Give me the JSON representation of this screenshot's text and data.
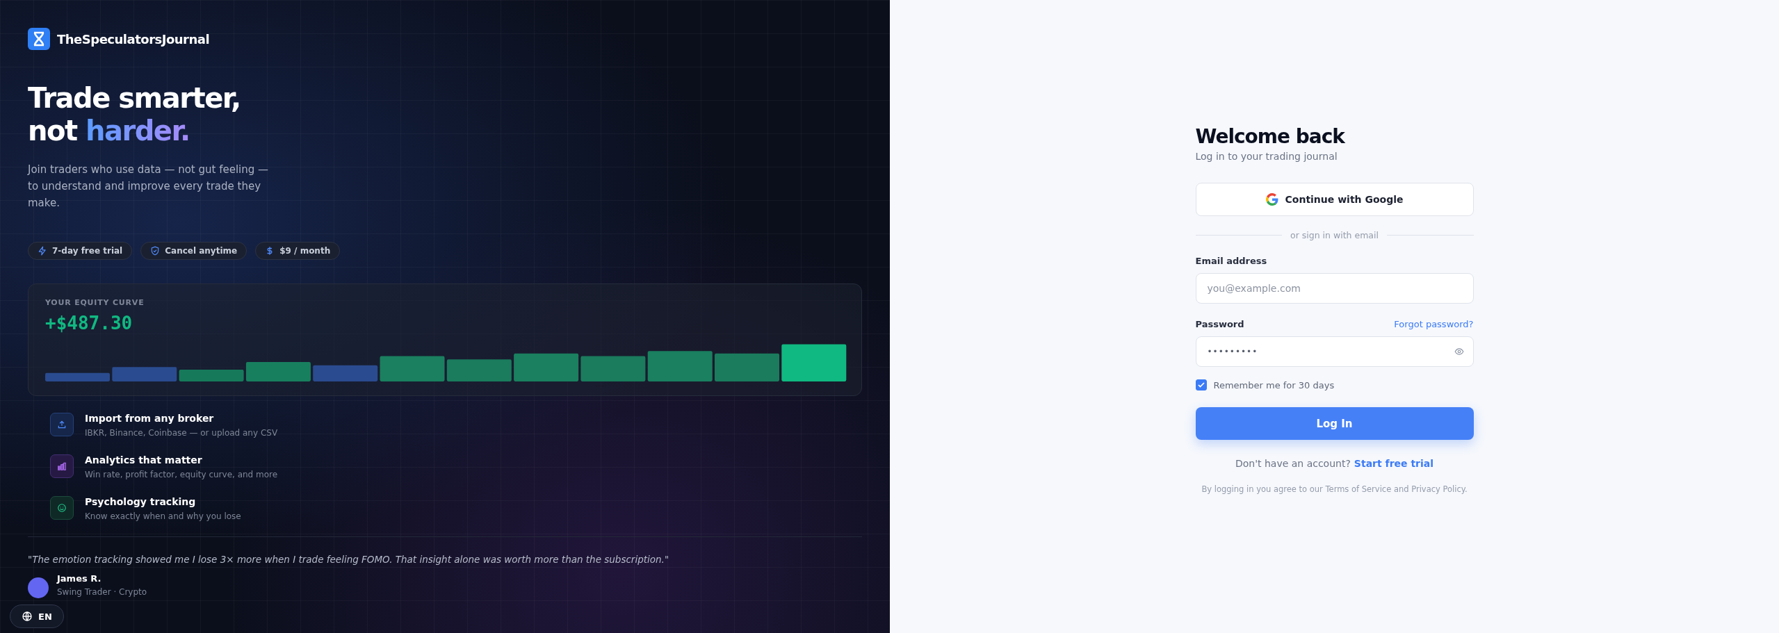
{
  "brand": {
    "name": "TheSpeculatorsJournal"
  },
  "hero": {
    "title_line_1": "Trade smarter,",
    "title_line_2_plain": "not",
    "title_line_2_accent": "harder.",
    "subtitle": "Join traders who use data — not gut feeling — to understand and improve every trade they make."
  },
  "badges": [
    {
      "kind": "bolt",
      "label": "7-day free trial"
    },
    {
      "kind": "shield",
      "label": "Cancel anytime"
    },
    {
      "kind": "dollar",
      "label": "$9 / month"
    }
  ],
  "equity_card": {
    "label": "YOUR EQUITY CURVE",
    "value": "+$487.30"
  },
  "features": [
    {
      "kind": "upload",
      "title": "Import from any broker",
      "description": "IBKR, Binance, Coinbase — or upload any CSV"
    },
    {
      "kind": "chart",
      "title": "Analytics that matter",
      "description": "Win rate, profit factor, equity curve, and more"
    },
    {
      "kind": "smile",
      "title": "Psychology tracking",
      "description": "Know exactly when and why you lose"
    }
  ],
  "testimonial": {
    "quote": "\"The emotion tracking showed me I lose 3× more when I trade feeling FOMO. That insight alone was worth more than the subscription.\"",
    "author": "James R.",
    "role": "Swing Trader · Crypto"
  },
  "language_button": {
    "label": "EN"
  },
  "login": {
    "title": "Welcome back",
    "subtitle": "Log in to your trading journal",
    "google_button": "Continue with Google",
    "divider": "or sign in with email",
    "email": {
      "label": "Email address",
      "placeholder": "you@example.com"
    },
    "password": {
      "label": "Password",
      "value": "•••••••••",
      "forgot_link": "Forgot password?"
    },
    "remember": {
      "label": "Remember me for 30 days",
      "checked": true
    },
    "submit": "Log In",
    "signup_prompt": "Don't have an account?",
    "signup_link": "Start free trial",
    "terms": "By logging in you agree to our Terms of Service and Privacy Policy."
  }
}
